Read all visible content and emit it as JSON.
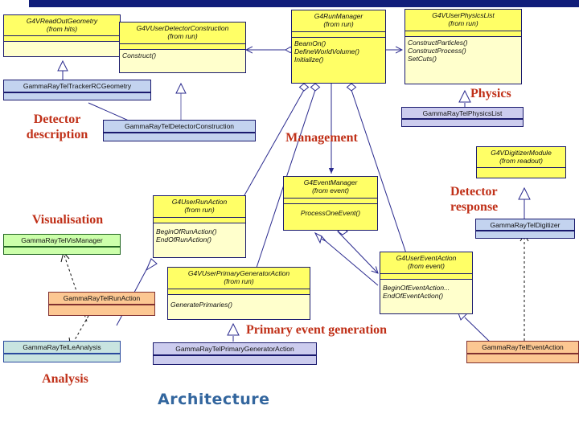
{
  "slide": {
    "title": "Architecture",
    "title_color": "#33669e",
    "topbar_color": "#111e7a"
  },
  "captions": [
    {
      "id": "detector-description",
      "text": "Detector\ndescription",
      "color": "#c03018"
    },
    {
      "id": "management",
      "text": "Management",
      "color": "#c03018"
    },
    {
      "id": "physics",
      "text": "Physics",
      "color": "#c03018"
    },
    {
      "id": "detector-response",
      "text": "Detector\nresponse",
      "color": "#c03018"
    },
    {
      "id": "visualisation",
      "text": "Visualisation",
      "color": "#c03018"
    },
    {
      "id": "analysis",
      "text": "Analysis",
      "color": "#c03018"
    },
    {
      "id": "primary-event-generation",
      "text": "Primary event generation",
      "color": "#c03018"
    }
  ],
  "classes": {
    "g4v_readout_geometry": {
      "name": "G4VReadOutGeometry",
      "package": "(from hits)",
      "operations": []
    },
    "g4v_user_detector_construction": {
      "name": "G4VUserDetectorConstruction",
      "package": "(from run)",
      "operations": [
        "Construct()"
      ]
    },
    "g4_run_manager": {
      "name": "G4RunManager",
      "package": "(from run)",
      "operations": [
        "BeamOn()",
        "DefineWorldVolume()",
        "Initialize()"
      ]
    },
    "g4v_user_physics_list": {
      "name": "G4VUserPhysicsList",
      "package": "(from run)",
      "operations": [
        "ConstructParticles()",
        "ConstructProcess()",
        "SetCuts()"
      ]
    },
    "g4v_digitizer_module": {
      "name": "G4VDigitizerModule",
      "package": "(from readout)",
      "operations": []
    },
    "g4_event_manager": {
      "name": "G4EventManager",
      "package": "(from event)",
      "operations": [
        "ProcessOneEvent()"
      ]
    },
    "g4_user_run_action": {
      "name": "G4UserRunAction",
      "package": "(from run)",
      "operations": [
        "BeginOfRunAction()",
        "EndOfRunAction()"
      ]
    },
    "g4v_user_primary_generator_action": {
      "name": "G4VUserPrimaryGeneratorAction",
      "package": "(from run)",
      "operations": [
        "GeneratePrimaries()"
      ]
    },
    "g4_user_event_action": {
      "name": "G4UserEventAction",
      "package": "(from event)",
      "operations": [
        "BeginOfEventAction...",
        "EndOfEventAction()"
      ]
    },
    "gammaray_tel_tracker_rc_geometry": {
      "name": "GammaRayTelTrackerRCGeometry"
    },
    "gammaray_tel_detector_construction": {
      "name": "GammaRayTelDetectorConstruction"
    },
    "gammaray_tel_physics_list": {
      "name": "GammaRayTelPhysicsList"
    },
    "gammaray_tel_digitizer": {
      "name": "GammaRayTelDigitizer"
    },
    "gammaray_tel_vis_manager": {
      "name": "GammaRayTelVisManager"
    },
    "gammaray_tel_run_action": {
      "name": "GammaRayTelRunAction"
    },
    "gammaray_tel_le_analysis": {
      "name": "GammaRayTelLeAnalysis"
    },
    "gammaray_tel_primary_generator_action": {
      "name": "GammaRayTelPrimaryGeneratorAction"
    },
    "gammaray_tel_event_action": {
      "name": "GammaRayTelEventAction"
    }
  },
  "colors": {
    "abstract_class_fill": "#ffff66",
    "abstract_class_body": "#ffffcc",
    "detector_fill": "#c3d3ef",
    "physics_fill": "#ccccee",
    "vis_fill": "#ccffaa",
    "run_action_fill": "#fcc792",
    "analysis_fill": "#c8e4e0",
    "border": "#1a1a6e",
    "caption": "#c03018",
    "title": "#33669e"
  }
}
